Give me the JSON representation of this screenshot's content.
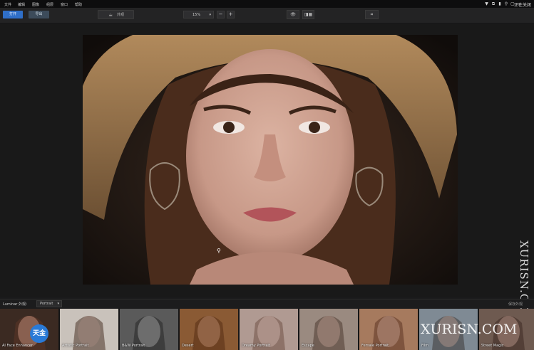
{
  "menu": {
    "items": [
      "文件",
      "编辑",
      "图像",
      "组层",
      "窗口",
      "帮助"
    ],
    "window_controls": [
      "▼",
      "⧉",
      "▮",
      "⚲",
      "▢",
      "—",
      "✕"
    ],
    "status": "正在关闭"
  },
  "toolbar": {
    "open_label": "打开",
    "export_label": "导出",
    "looks_label": "外观",
    "zoom_value": "15%",
    "zoom_out": "−",
    "zoom_in": "+",
    "compare_label": "◨▦"
  },
  "looks_panel": {
    "title": "Luminar 外观：",
    "category": "Portrait",
    "save_label": "保存外观"
  },
  "presets": [
    "AI Face Enhancer",
    "Artistic Portrait",
    "B&W Portrait",
    "Desert",
    "Dreamy Portrait",
    "Escape",
    "Female Portrait",
    "Film",
    "Street Magic"
  ],
  "watermark": {
    "vertical": "XURISN.COM",
    "horizontal": "XURISN.COM",
    "badge": "天金"
  },
  "colors": {
    "accent": "#2f6fc8",
    "background": "#1b1b1c"
  }
}
